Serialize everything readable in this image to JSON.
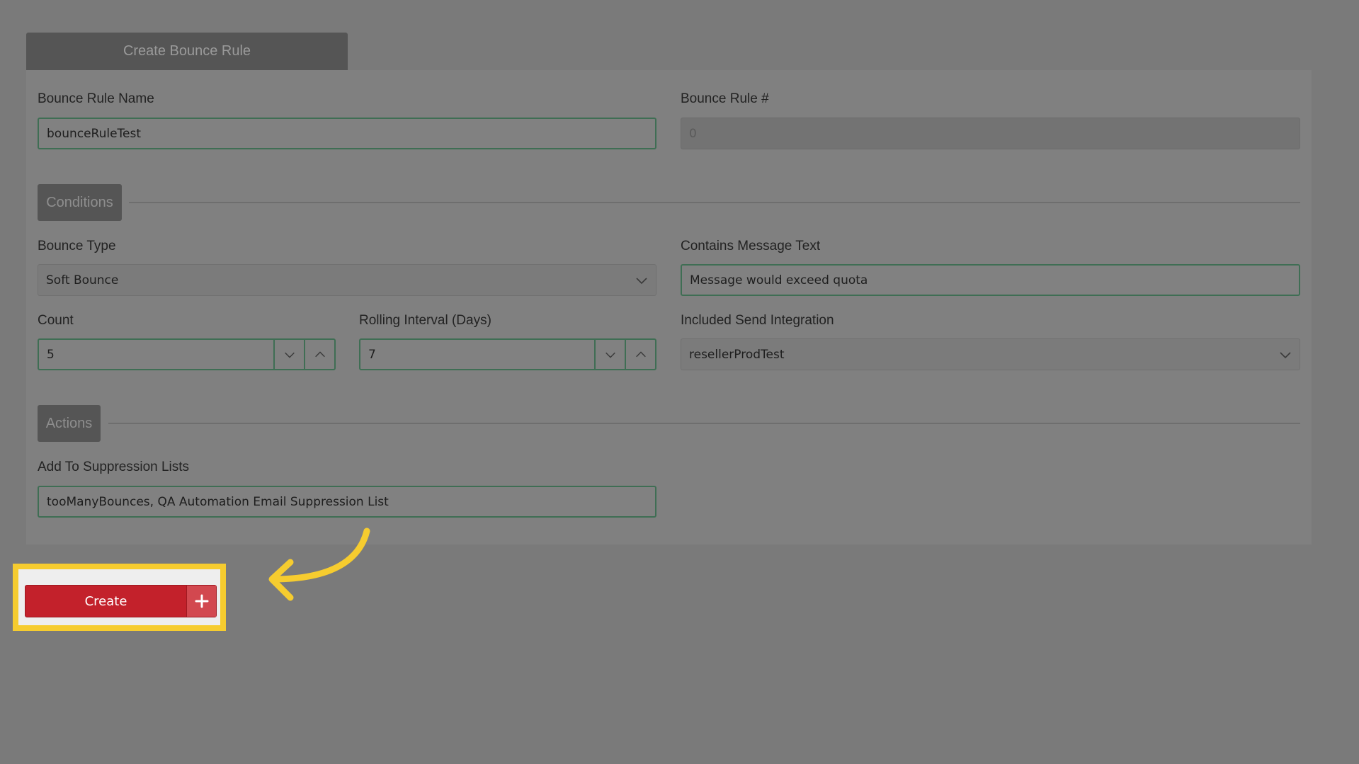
{
  "header": {
    "tab_label": "Create Bounce Rule"
  },
  "form": {
    "rule_name": {
      "label": "Bounce Rule Name",
      "value": "bounceRuleTest"
    },
    "rule_number": {
      "label": "Bounce Rule #",
      "value": "0"
    },
    "conditions": {
      "section_label": "Conditions",
      "bounce_type": {
        "label": "Bounce Type",
        "value": "Soft Bounce"
      },
      "message_text": {
        "label": "Contains Message Text",
        "value": "Message would exceed quota"
      },
      "count": {
        "label": "Count",
        "value": "5"
      },
      "rolling_interval": {
        "label": "Rolling Interval (Days)",
        "value": "7"
      },
      "send_integration": {
        "label": "Included Send Integration",
        "value": "resellerProdTest"
      }
    },
    "actions": {
      "section_label": "Actions",
      "suppression_lists": {
        "label": "Add To Suppression Lists",
        "value": "tooManyBounces, QA Automation Email Suppression List"
      }
    }
  },
  "footer": {
    "create_label": "Create"
  },
  "colors": {
    "overlay": "#7a7a7a",
    "create_button": "#c3212b",
    "highlight": "#f6cc2f",
    "field_border": "#3f6e54"
  },
  "icons": [
    "chevron-down-icon",
    "chevron-up-icon",
    "plus-icon",
    "curved-arrow-icon"
  ]
}
